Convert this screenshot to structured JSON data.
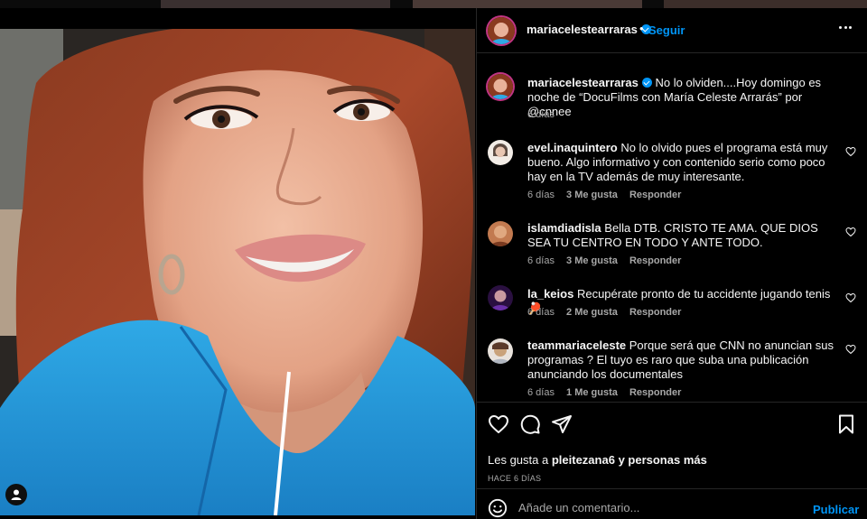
{
  "thumbnails": [
    "",
    "",
    "",
    ""
  ],
  "post": {
    "image_alt": "Selfie de María Celeste Arrarás"
  },
  "header": {
    "username": "mariacelestearraras",
    "separator": "•",
    "follow_label": "Seguir",
    "more_icon": "more-horizontal-icon"
  },
  "caption": {
    "username": "mariacelestearraras",
    "text": "No lo olviden....Hoy domingo es noche de “DocuFilms con María Celeste Arrarás” por @cnnee",
    "time": "6 días"
  },
  "comments": [
    {
      "username": "evel.inaquintero",
      "text": "No lo olvido pues el programa está muy bueno. Algo informativo y con contenido serio como poco hay en la TV además de muy interesante.",
      "time": "6 días",
      "likes": "3 Me gusta",
      "reply": "Responder",
      "avatar_color": "#d9b8a8"
    },
    {
      "username": "islamdiadisla",
      "text": "Bella DTB. CRISTO TE AMA. QUE DIOS SEA TU CENTRO EN TODO Y ANTE TODO.",
      "time": "6 días",
      "likes": "3 Me gusta",
      "reply": "Responder",
      "avatar_color": "#a0603c"
    },
    {
      "username": "la_keios",
      "text": "Recupérate pronto de tu accidente jugando tenis 🏓",
      "time": "6 días",
      "likes": "2 Me gusta",
      "reply": "Responder",
      "avatar_color": "#5a2a88"
    },
    {
      "username": "teammariaceleste",
      "text": "Porque será que CNN no anuncian sus programas ? El tuyo es raro que suba una publicación anunciando los documentales",
      "time": "6 días",
      "likes": "1 Me gusta",
      "reply": "Responder",
      "avatar_color": "#c9a27a"
    }
  ],
  "actions": {
    "like_icon": "heart-icon",
    "comment_icon": "comment-icon",
    "share_icon": "paper-plane-icon",
    "save_icon": "bookmark-icon",
    "likes_prefix": "Les gusta a",
    "likes_user": "pleitezana6",
    "likes_suffix": "y personas más",
    "date": "HACE 6 DÍAS"
  },
  "composer": {
    "placeholder": "Añade un comentario...",
    "publish_label": "Publicar",
    "emoji_icon": "emoji-icon"
  },
  "colors": {
    "accent": "#0095f6",
    "background": "#000000",
    "secondary_text": "#a8a8a8",
    "divider": "#262626"
  }
}
